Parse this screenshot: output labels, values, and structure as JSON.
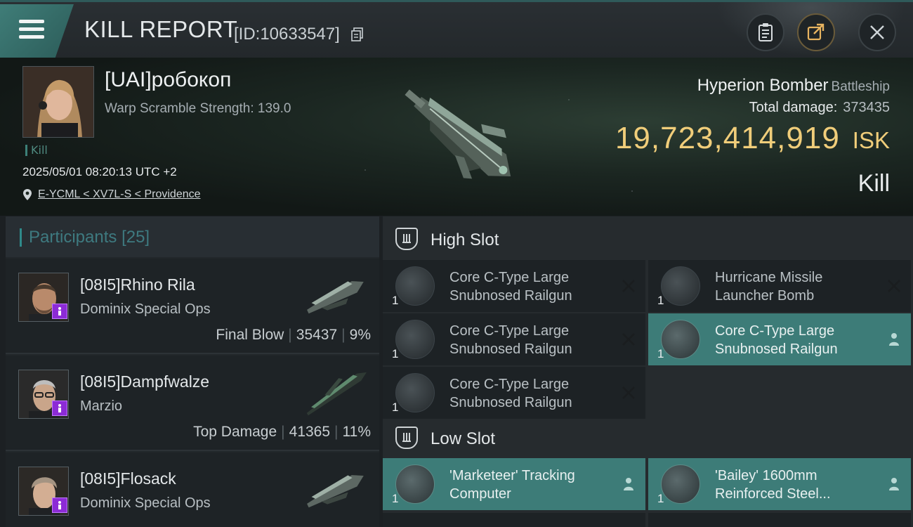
{
  "header": {
    "title": "KILL REPORT",
    "report_id": "[ID:10633547]",
    "icons": [
      "menu-icon",
      "copy-icon",
      "clipboard-icon",
      "share-icon",
      "close-icon"
    ],
    "accent_color": "#3f7d78"
  },
  "victim": {
    "name": "[UAI]робокоп",
    "warp_scramble": "Warp Scramble Strength: 139.0",
    "tag": "Kill",
    "time": "2025/05/01 08:20:13 UTC +2",
    "location": "E-YCML < XV7L-S < Providence",
    "ship_name": "Hyperion Bomber",
    "ship_class": "Battleship",
    "total_damage_label": "Total damage:",
    "total_damage": "373435",
    "isk_value": "19,723,414,919",
    "isk_unit": "ISK",
    "result": "Kill",
    "isk_color": "#f0cd7a"
  },
  "participants": {
    "label": "Participants",
    "count": "[25]",
    "rows": [
      {
        "name": "[08I5]Rhino Rila",
        "ship": "Dominix Special Ops",
        "role": "Final Blow",
        "damage": "35437",
        "percent": "9%"
      },
      {
        "name": "[08I5]Dampfwalze",
        "ship": "Marzio",
        "role": "Top Damage",
        "damage": "41365",
        "percent": "11%"
      },
      {
        "name": "[08I5]Flosack",
        "ship": "Dominix Special Ops",
        "role": "",
        "damage": "",
        "percent": ""
      }
    ]
  },
  "fitting": {
    "high_slot_label": "High Slot",
    "low_slot_label": "Low Slot",
    "high_modules": [
      {
        "qty": "1",
        "name": "Core C-Type Large Snubnosed Railgun",
        "status": "destroyed"
      },
      {
        "qty": "1",
        "name": "Hurricane Missile Launcher Bomb",
        "status": "destroyed"
      },
      {
        "qty": "1",
        "name": "Core C-Type Large Snubnosed Railgun",
        "status": "destroyed"
      },
      {
        "qty": "1",
        "name": "Core C-Type Large Snubnosed Railgun",
        "status": "dropped"
      },
      {
        "qty": "1",
        "name": "Core C-Type Large Snubnosed Railgun",
        "status": "destroyed"
      }
    ],
    "low_modules": [
      {
        "qty": "1",
        "name": "'Marketeer' Tracking Computer",
        "status": "dropped"
      },
      {
        "qty": "1",
        "name": "'Bailey' 1600mm Reinforced Steel...",
        "status": "dropped"
      }
    ]
  }
}
